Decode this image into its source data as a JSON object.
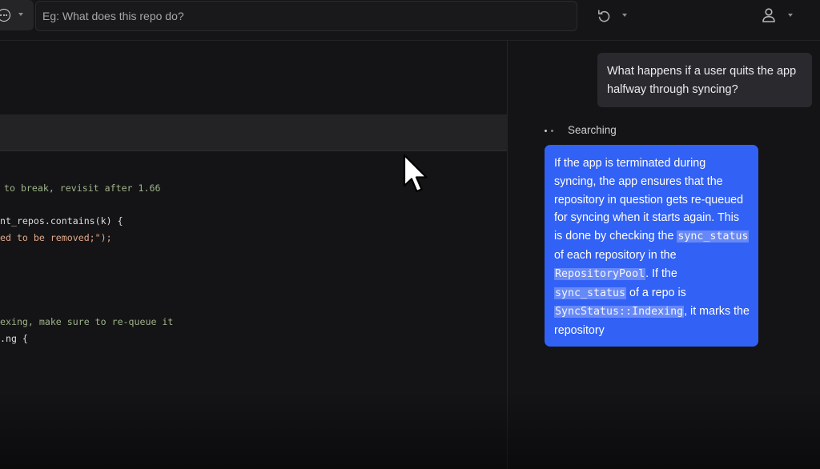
{
  "topbar": {
    "mode_icon": "chat-bubble-ellipsis-icon",
    "search_placeholder": "Eg: What does this repo do?",
    "undo_icon": "undo-icon",
    "user_icon": "user-icon"
  },
  "code": {
    "lines": [
      "to break, revisit after 1.66",
      "nt_repos.contains(k) {",
      "ed to be removed;\");",
      "exing, make sure to re-queue it",
      ".ng {"
    ]
  },
  "chat": {
    "user_message": "What happens if a user quits the app halfway through syncing?",
    "status": "Searching",
    "answer": {
      "p1": "If the app is terminated during syncing, the app ensures that the repository in question gets re-queued for syncing when it starts again. This is done by checking the ",
      "code1": "sync_status",
      "p2": " of each repository in the ",
      "code2": "RepositoryPool",
      "p3": ". If the ",
      "code3": "sync_status",
      "p4": " of a repo is ",
      "code4": "SyncStatus::Indexing",
      "p5": ", it marks the repository"
    }
  },
  "colors": {
    "answer_bubble": "#3261f5",
    "background": "#121214",
    "comment": "#9fb38a",
    "string": "#e3a98a"
  }
}
